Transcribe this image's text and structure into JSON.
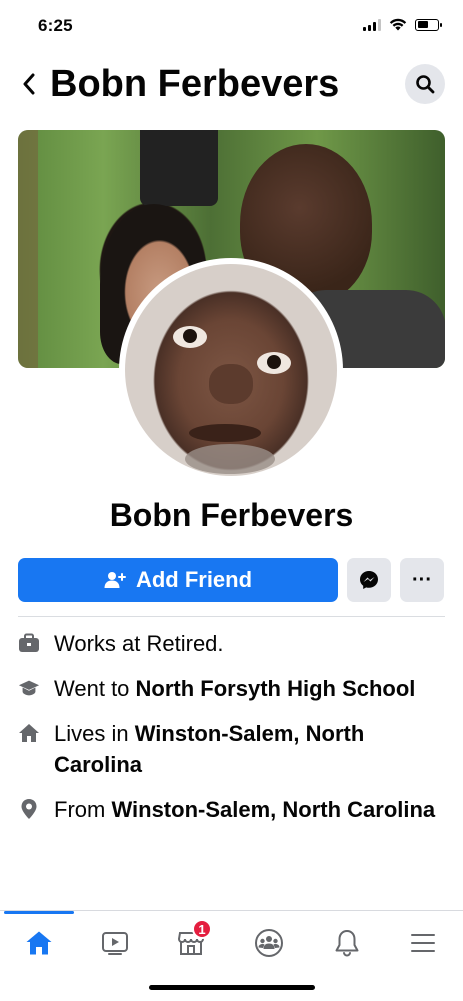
{
  "status_bar": {
    "time": "6:25"
  },
  "header": {
    "title": "Bobn Ferbevers",
    "back_icon": "chevron-left-icon",
    "search_icon": "search-icon"
  },
  "profile": {
    "name": "Bobn Ferbevers"
  },
  "actions": {
    "add_friend_label": "Add Friend",
    "more_label": "···"
  },
  "details": [
    {
      "icon": "briefcase-icon",
      "prefix": "Works at Retired.",
      "value": ""
    },
    {
      "icon": "graduation-cap-icon",
      "prefix": "Went to ",
      "value": "North Forsyth High School"
    },
    {
      "icon": "home-icon",
      "prefix": "Lives in ",
      "value": "Winston-Salem, North Carolina"
    },
    {
      "icon": "location-pin-icon",
      "prefix": "From ",
      "value": "Winston-Salem, North Carolina"
    }
  ],
  "tabbar": {
    "tabs": [
      "home",
      "watch",
      "marketplace",
      "groups",
      "notifications",
      "menu"
    ],
    "marketplace_badge": "1",
    "active": "home"
  },
  "colors": {
    "accent": "#1877f2",
    "badge": "#e41e3f",
    "button_bg": "#e4e6eb"
  }
}
